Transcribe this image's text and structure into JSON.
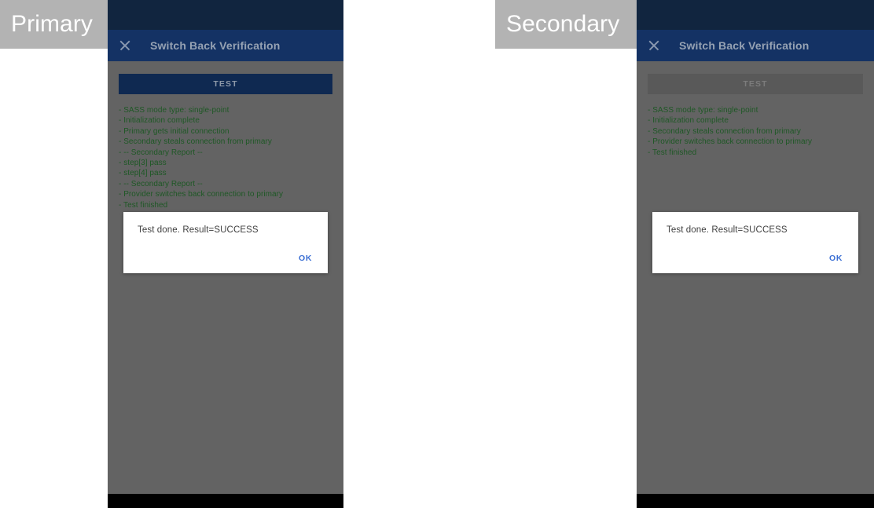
{
  "labels": {
    "primary": "Primary",
    "secondary": "Secondary"
  },
  "app_bar": {
    "close_icon": "close-icon",
    "title": "Switch Back Verification"
  },
  "buttons": {
    "test_label": "TEST"
  },
  "dialog": {
    "message": "Test done. Result=SUCCESS",
    "ok_label": "OK",
    "ok_color": "#3b6fd4"
  },
  "colors": {
    "status_bar": "#11253f",
    "app_bar": "#143264",
    "content_scrim": "#636363",
    "test_button_enabled": "#0f2951",
    "test_button_disabled": "#595959",
    "log_text": "#1e5825",
    "label_chip": "#b3b3b3"
  },
  "primary": {
    "test_button_state": "enabled",
    "log": [
      "- SASS mode type: single-point",
      "- Initialization complete",
      "- Primary gets initial connection",
      "- Secondary steals connection from primary",
      "- -- Secondary Report --",
      "- step[3] pass",
      "- step[4] pass",
      "- -- Secondary Report --",
      "- Provider switches back connection to primary",
      "- Test finished"
    ]
  },
  "secondary": {
    "test_button_state": "disabled",
    "log": [
      "- SASS mode type: single-point",
      "- Initialization complete",
      "- Secondary steals connection from primary",
      "- Provider switches back connection to primary",
      "- Test finished"
    ]
  }
}
